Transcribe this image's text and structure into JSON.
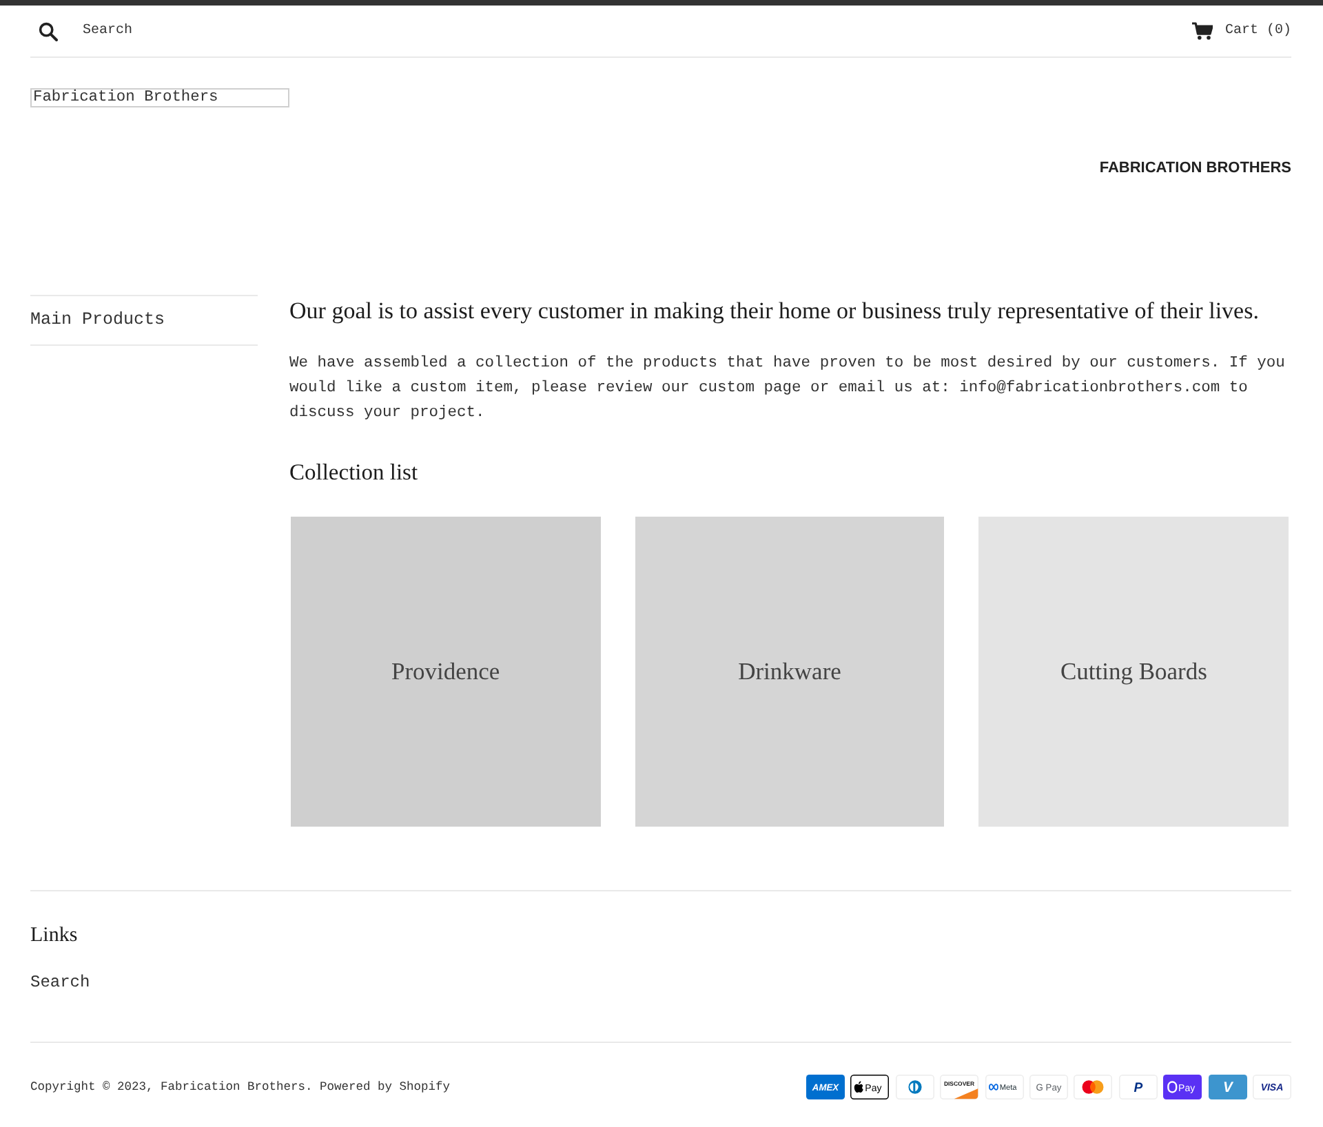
{
  "header": {
    "search": {
      "placeholder": "Search"
    },
    "cart": {
      "label": "Cart (0)"
    }
  },
  "logo": {
    "alt_text": "Fabrication Brothers"
  },
  "banner": {
    "title": "FABRICATION BROTHERS"
  },
  "sidebar": {
    "items": [
      {
        "label": "Main Products"
      }
    ]
  },
  "main": {
    "heading": "Our goal is to assist every customer in making their home or business truly representative of their lives.",
    "intro": "We have assembled a collection of the products that have proven to be most desired by our customers. If you would like a custom item, please review our custom page or email us at: info@fabricationbrothers.com to discuss your project.",
    "collections": {
      "title": "Collection list",
      "items": [
        {
          "title": "Providence",
          "color": "#cfcfcf"
        },
        {
          "title": "Drinkware",
          "color": "#d5d5d5"
        },
        {
          "title": "Cutting Boards",
          "color": "#e4e4e4"
        }
      ]
    }
  },
  "footer": {
    "links": {
      "title": "Links",
      "items": [
        {
          "label": "Search"
        }
      ]
    },
    "copyright": "Copyright © 2023, Fabrication Brothers. Powered by Shopify",
    "payment_methods": [
      {
        "kind": "amex",
        "text": "AMEX"
      },
      {
        "kind": "apple_pay",
        "text": "Pay"
      },
      {
        "kind": "diners"
      },
      {
        "kind": "discover",
        "text": "DISCOVER"
      },
      {
        "kind": "meta_pay",
        "text": "Meta"
      },
      {
        "kind": "google_pay",
        "text": "G Pay"
      },
      {
        "kind": "mastercard"
      },
      {
        "kind": "paypal",
        "text": "P"
      },
      {
        "kind": "shop_pay",
        "text": "Pay"
      },
      {
        "kind": "venmo",
        "text": "V"
      },
      {
        "kind": "visa",
        "text": "VISA"
      }
    ]
  }
}
